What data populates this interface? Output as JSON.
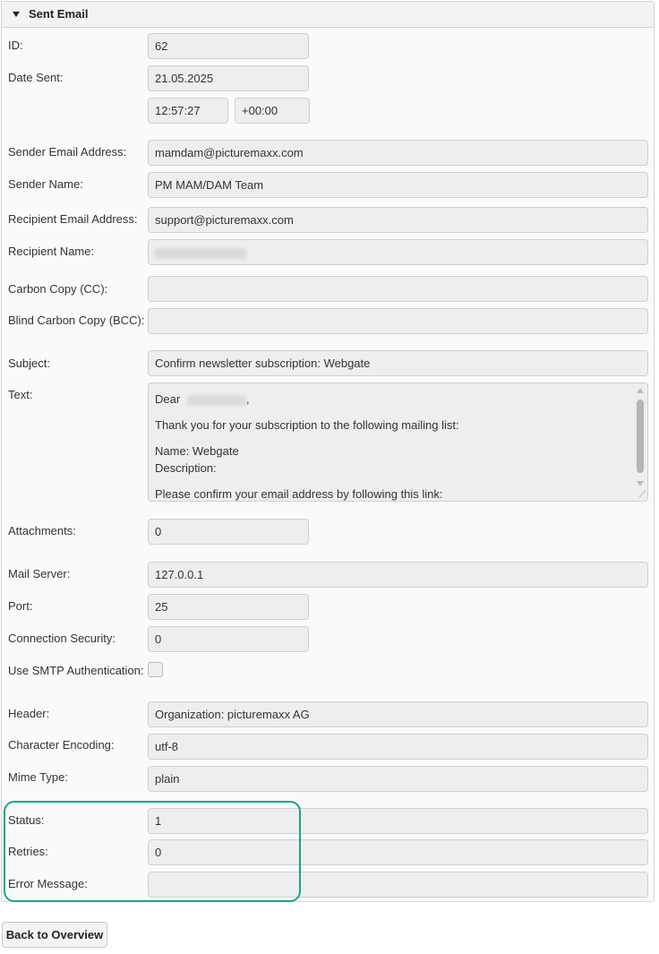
{
  "panel": {
    "title": "Sent Email"
  },
  "fields": {
    "id": {
      "label": "ID:",
      "value": "62"
    },
    "date_sent": {
      "label": "Date Sent:",
      "date": "21.05.2025",
      "time": "12:57:27",
      "timezone": "+00:00"
    },
    "sender_email": {
      "label": "Sender Email Address:",
      "value": "mamdam@picturemaxx.com"
    },
    "sender_name": {
      "label": "Sender Name:",
      "value": "PM MAM/DAM Team"
    },
    "recipient_email": {
      "label": "Recipient Email Address:",
      "value": "support@picturemaxx.com"
    },
    "recipient_name": {
      "label": "Recipient Name:",
      "value": ""
    },
    "cc": {
      "label": "Carbon Copy (CC):",
      "value": ""
    },
    "bcc": {
      "label": "Blind Carbon Copy (BCC):",
      "value": ""
    },
    "subject": {
      "label": "Subject:",
      "value": "Confirm newsletter subscription: Webgate"
    },
    "text": {
      "label": "Text:",
      "greeting": "Dear",
      "greeting_end": ",",
      "line1": "Thank you for your subscription to the following mailing list:",
      "name_line": "Name: Webgate",
      "description_line": "Description:",
      "confirm_line": "Please confirm your email address by following this link:"
    },
    "attachments": {
      "label": "Attachments:",
      "value": "0"
    },
    "mail_server": {
      "label": "Mail Server:",
      "value": "127.0.0.1"
    },
    "port": {
      "label": "Port:",
      "value": "25"
    },
    "connection_security": {
      "label": "Connection Security:",
      "value": "0"
    },
    "smtp_auth": {
      "label": "Use SMTP Authentication:",
      "checked": false
    },
    "header": {
      "label": "Header:",
      "value": "Organization: picturemaxx AG"
    },
    "encoding": {
      "label": "Character Encoding:",
      "value": "utf-8"
    },
    "mime_type": {
      "label": "Mime Type:",
      "value": "plain"
    },
    "status": {
      "label": "Status:",
      "value": "1"
    },
    "retries": {
      "label": "Retries:",
      "value": "0"
    },
    "error_message": {
      "label": "Error Message:",
      "value": ""
    }
  },
  "buttons": {
    "back": "Back to Overview"
  },
  "colors": {
    "highlight": "#17a589",
    "field_bg": "#eeeeee",
    "panel_bg": "#fafafa"
  }
}
